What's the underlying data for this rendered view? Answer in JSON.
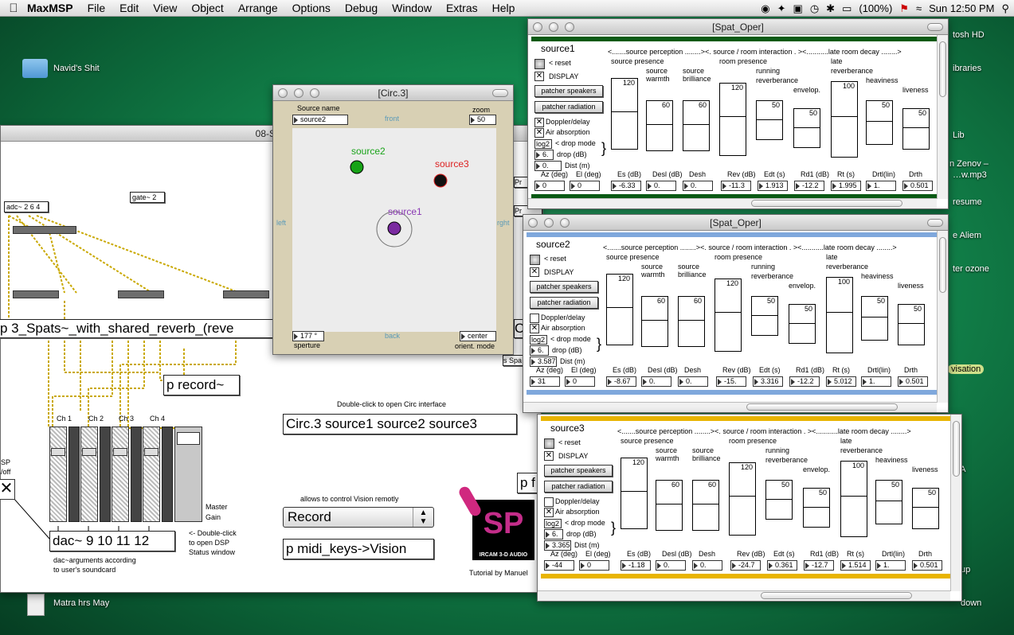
{
  "menubar": {
    "app": "MaxMSP",
    "items": [
      "File",
      "Edit",
      "View",
      "Object",
      "Arrange",
      "Options",
      "Debug",
      "Window",
      "Extras",
      "Help"
    ],
    "battery": "(100%)",
    "clock": "Sun 12:50 PM"
  },
  "desktop": {
    "folder": "Navid's Shit",
    "file": "Matra hrs May",
    "right_labels": [
      "tosh HD",
      "ibraries",
      "Lib",
      "n Zenov –",
      "…w.mp3",
      "resume",
      "e Aliem",
      "ter ozone",
      "visation",
      "LIA",
      "up",
      "down"
    ]
  },
  "main_patcher": {
    "title": "08-Spa",
    "adc": "adc~ 2 6 4",
    "gate": "gate~ 2",
    "spats": "p 3_Spats~_with_shared_reverb_(reve",
    "record": "p record~",
    "channels": [
      "Ch 1",
      "Ch 2",
      "Ch 3",
      "Ch 4"
    ],
    "master": "Master",
    "gain": "Gain",
    "dac": "dac~ 9 10 11 12",
    "dac_note1": "dac~arguments according",
    "dac_note2": "to user's soundcard",
    "dsp_note": [
      "<- Double-click",
      "to open DSP",
      "Status window"
    ],
    "dsp_onoff": [
      "SP",
      "/off"
    ],
    "circ_note": "Double-click to open Circ interface",
    "circ": "Circ.3 source1 source2 source3",
    "vision_note": "allows to control Vision remotly",
    "record_menu": "Record",
    "midi": "p midi_keys->Vision",
    "tutorial": "Tutorial by Manuel",
    "logo_text": "SP",
    "ircam": "IRCAM 3-D AUDIO",
    "pf": "p f",
    "side_labels": [
      "Pr",
      "Pr",
      "C",
      "s Spa"
    ]
  },
  "circ_window": {
    "title": "[Circ.3]",
    "source_name_label": "Source name",
    "source_name": "source2",
    "zoom_label": "zoom",
    "zoom": "50",
    "front": "front",
    "back": "back",
    "left": "left",
    "right": "rght",
    "sources": [
      "source2",
      "source3",
      "source1"
    ],
    "aperture": "177 °",
    "aperture_label": "sperture",
    "orient": "center",
    "orient_label": "orient. mode"
  },
  "spat_windows": [
    {
      "title": "[Spat_Oper]",
      "source": "source1",
      "color": "#0a5a14",
      "values": {
        "az": "0",
        "el": "0",
        "es": "-6.33",
        "desl": "0.",
        "desh": "0.",
        "rev": "-11.3",
        "edt": "1.913",
        "rd1": "-12.2",
        "rt": "1.995",
        "drtl": "1.",
        "drth": "0.501",
        "dist": "0.",
        "drop": "6.",
        "mode": "log2"
      },
      "sliders": [
        "120",
        "60",
        "60",
        "120",
        "50",
        "50",
        "100",
        "50",
        "50"
      ],
      "doppler": true
    },
    {
      "title": "[Spat_Oper]",
      "source": "source2",
      "color": "#7fa8dc",
      "values": {
        "az": "31",
        "el": "0",
        "es": "-8.67",
        "desl": "0.",
        "desh": "0.",
        "rev": "-15.",
        "edt": "3.316",
        "rd1": "-12.2",
        "rt": "5.012",
        "drtl": "1.",
        "drth": "0.501",
        "dist": "3.5878",
        "drop": "6.",
        "mode": "log2"
      },
      "sliders": [
        "120",
        "60",
        "60",
        "120",
        "50",
        "50",
        "100",
        "50",
        "50"
      ],
      "doppler": false
    },
    {
      "title": "[Spat_Oper]",
      "source": "source3",
      "color": "#e8b400",
      "values": {
        "az": "-44",
        "el": "0",
        "es": "-1.18",
        "desl": "0.",
        "desh": "0.",
        "rev": "-24.7",
        "edt": "0.361",
        "rd1": "-12.7",
        "rt": "1.514",
        "drtl": "1.",
        "drth": "0.501",
        "dist": "3.3659",
        "drop": "6.",
        "mode": "log2"
      },
      "sliders": [
        "120",
        "60",
        "60",
        "120",
        "50",
        "50",
        "100",
        "50",
        "50"
      ],
      "doppler": false
    }
  ],
  "spat_labels": {
    "reset": "< reset",
    "display": "DISPLAY",
    "speakers": "patcher speakers",
    "radiation": "patcher radiation",
    "doppler": "Doppler/delay",
    "air": "Air absorption",
    "drop_mode": "< drop mode",
    "drop_db": "drop (dB)",
    "dist": "Dist (m)",
    "header": "<.......source perception ........><. source / room interaction . ><...........late room decay ........>",
    "source_presence": "source presence",
    "source_warmth": [
      "source",
      "warmth"
    ],
    "source_brilliance": [
      "source",
      "brilliance"
    ],
    "room_presence": "room presence",
    "running_rev": [
      "running",
      "reverberance"
    ],
    "envelop": "envelop.",
    "late_rev": [
      "late",
      "reverberance"
    ],
    "heaviness": "heaviness",
    "liveness": "liveness",
    "az": "Az (deg)",
    "el": "El (deg)",
    "es": "Es  (dB)",
    "desl": "Desl  (dB)",
    "desh": "Desh",
    "rev": "Rev  (dB)",
    "edt": "Edt (s)",
    "rd1": "Rd1  (dB)",
    "rt": "Rt (s)",
    "drtl": "Drtl",
    "lin": "(lin)",
    "drth": "Drth"
  }
}
